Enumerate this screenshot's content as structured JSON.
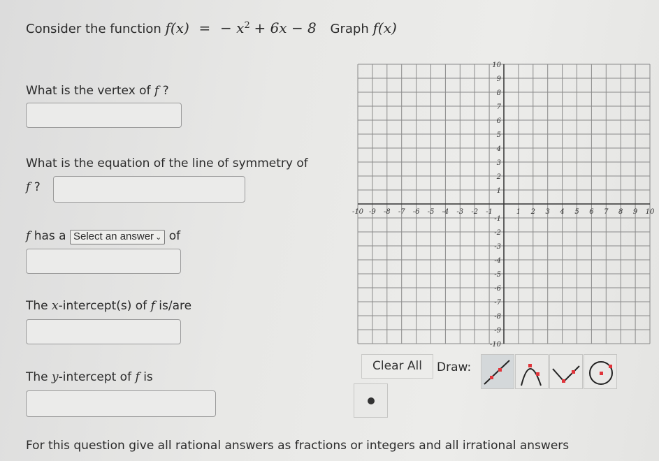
{
  "header": {
    "intro": "Consider the function",
    "function_lhs": "f(x)",
    "function_eq": "=",
    "function_rhs_a": "− x",
    "function_rhs_exp": "2",
    "function_rhs_b": "+ 6x − 8",
    "graph_label": "Graph",
    "graph_func": "f(x)"
  },
  "questions": {
    "vertex": {
      "label": "What is the vertex of",
      "var": "f",
      "suffix": "?",
      "value": ""
    },
    "symmetry": {
      "label": "What is the equation of the line of symmetry of",
      "var": "f",
      "suffix": "?",
      "value": ""
    },
    "extremum": {
      "var": "f",
      "prefix": "has a",
      "select_value": "Select an answer",
      "suffix": "of",
      "value": ""
    },
    "x_intercepts": {
      "prefix": "The",
      "axis_var": "x",
      "label": "-intercept(s) of",
      "var": "f",
      "suffix": "is/are",
      "value": ""
    },
    "y_intercept": {
      "prefix": "The",
      "axis_var": "y",
      "label": "-intercept of",
      "var": "f",
      "suffix": "is",
      "value": ""
    }
  },
  "graph": {
    "x_range": [
      -10,
      10
    ],
    "y_range": [
      -10,
      10
    ],
    "grid": true,
    "x_tick_labels": [
      "-10",
      "-9",
      "-8",
      "-7",
      "-6",
      "-5",
      "-4",
      "-3",
      "-2",
      "-1",
      "1",
      "2",
      "3",
      "4",
      "5",
      "6",
      "7",
      "8",
      "9",
      "10"
    ],
    "y_tick_labels": [
      "10",
      "9",
      "8",
      "7",
      "6",
      "5",
      "4",
      "3",
      "2",
      "1",
      "-1",
      "-2",
      "-3",
      "-4",
      "-5",
      "-6",
      "-7",
      "-8",
      "-9",
      "-10"
    ]
  },
  "toolbar": {
    "clear_all": "Clear All",
    "draw_label": "Draw:",
    "tools": [
      {
        "name": "line-tool",
        "active": true
      },
      {
        "name": "parabola-tool",
        "active": false
      },
      {
        "name": "absolute-value-tool",
        "active": false
      },
      {
        "name": "circle-tool",
        "active": false
      },
      {
        "name": "point-tool",
        "active": false
      }
    ],
    "point_color": "#e0343a"
  },
  "footer": {
    "note": "For this question give all rational answers as fractions or integers and all irrational answers"
  }
}
